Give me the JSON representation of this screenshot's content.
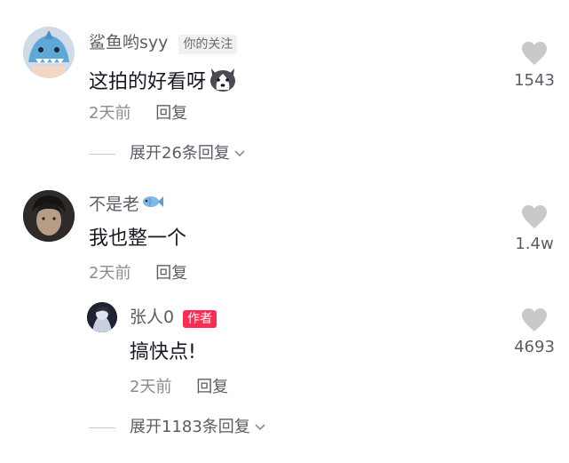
{
  "comments": [
    {
      "user": "鲨鱼哟syy",
      "tag": "你的关注",
      "text": "这拍的好看呀",
      "emoji": "husky-dog-emoji",
      "time": "2天前",
      "reply_label": "回复",
      "likes": "1543",
      "expand_label": "展开26条回复"
    },
    {
      "user": "不是老",
      "user_emoji": "fish-emoji",
      "text": "我也整一个",
      "time": "2天前",
      "reply_label": "回复",
      "likes": "1.4w",
      "reply": {
        "user": "张人0",
        "tag": "作者",
        "text": "搞快点!",
        "time": "2天前",
        "reply_label": "回复",
        "likes": "4693"
      },
      "expand_label": "展开1183条回复"
    }
  ],
  "colors": {
    "author_tag": "#fe2c55",
    "like_icon": "#c9c9cc",
    "secondary_text": "#8a8b91"
  }
}
